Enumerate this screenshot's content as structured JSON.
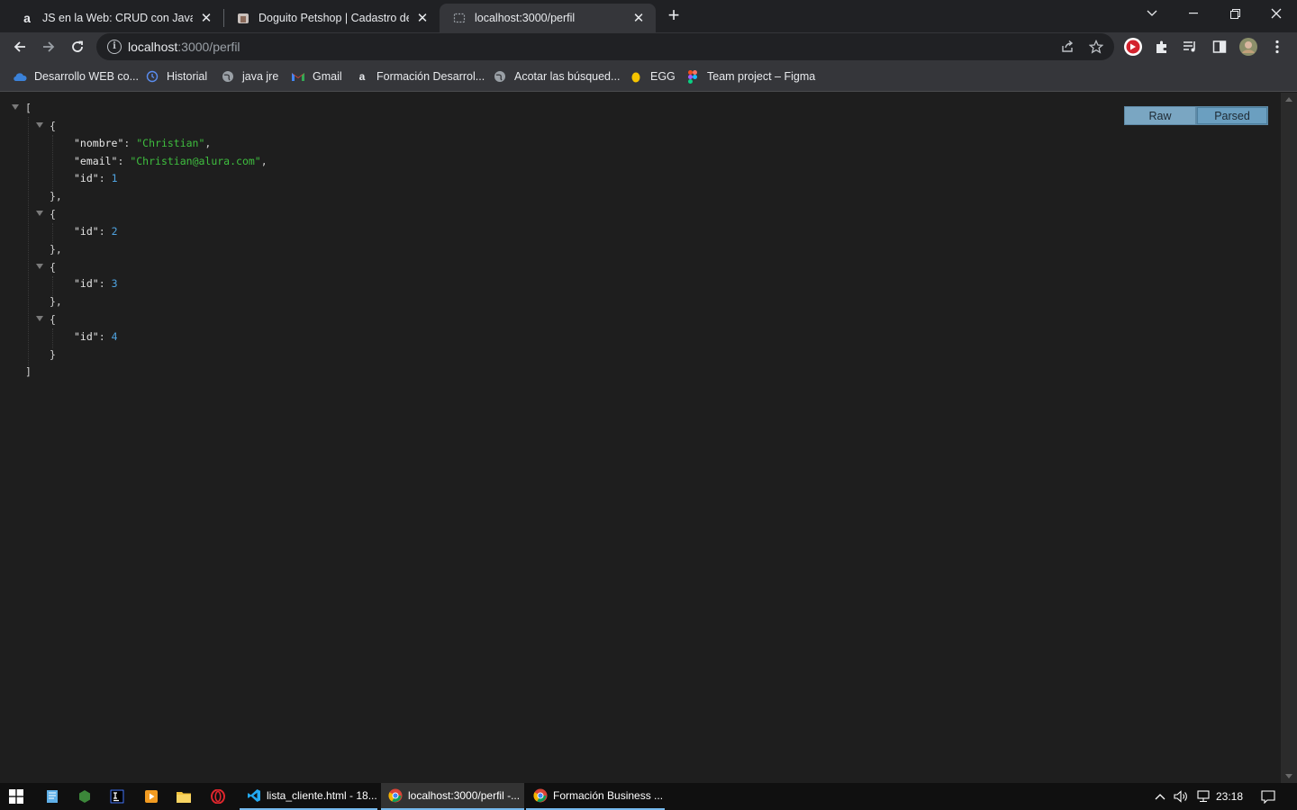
{
  "browser": {
    "tabs": [
      {
        "title": "JS en la Web: CRUD con JavaScript",
        "favicon": "alura-a-icon"
      },
      {
        "title": "Doguito Petshop | Cadastro de cl",
        "favicon": "doguito-icon"
      },
      {
        "title": "localhost:3000/perfil",
        "favicon": "page-icon"
      }
    ],
    "url_host": "localhost",
    "url_rest": ":3000/perfil",
    "bookmarks": [
      {
        "label": "Desarrollo WEB co..."
      },
      {
        "label": "Historial"
      },
      {
        "label": "java jre"
      },
      {
        "label": "Gmail"
      },
      {
        "label": "Formación Desarrol..."
      },
      {
        "label": "Acotar las búsqued..."
      },
      {
        "label": "EGG"
      },
      {
        "label": "Team project – Figma"
      }
    ]
  },
  "viewer": {
    "raw_label": "Raw",
    "parsed_label": "Parsed",
    "json": {
      "open_bracket": "[",
      "close_bracket": "]",
      "records": [
        {
          "nombre": "\"Christian\"",
          "email": "\"Christian@alura.com\"",
          "id": "1"
        },
        {
          "id": "2"
        },
        {
          "id": "3"
        },
        {
          "id": "4"
        }
      ],
      "keys": {
        "nombre": "\"nombre\"",
        "email": "\"email\"",
        "id": "\"id\""
      }
    }
  },
  "taskbar": {
    "apps": [
      {
        "label": "lista_cliente.html - 18..."
      },
      {
        "label": "localhost:3000/perfil -..."
      },
      {
        "label": "Formación Business ..."
      }
    ],
    "time": "23:18"
  },
  "colors": {
    "json_string": "#3fbf3f",
    "json_number": "#4fa3e0",
    "button_bg": "#7aa6c2"
  }
}
